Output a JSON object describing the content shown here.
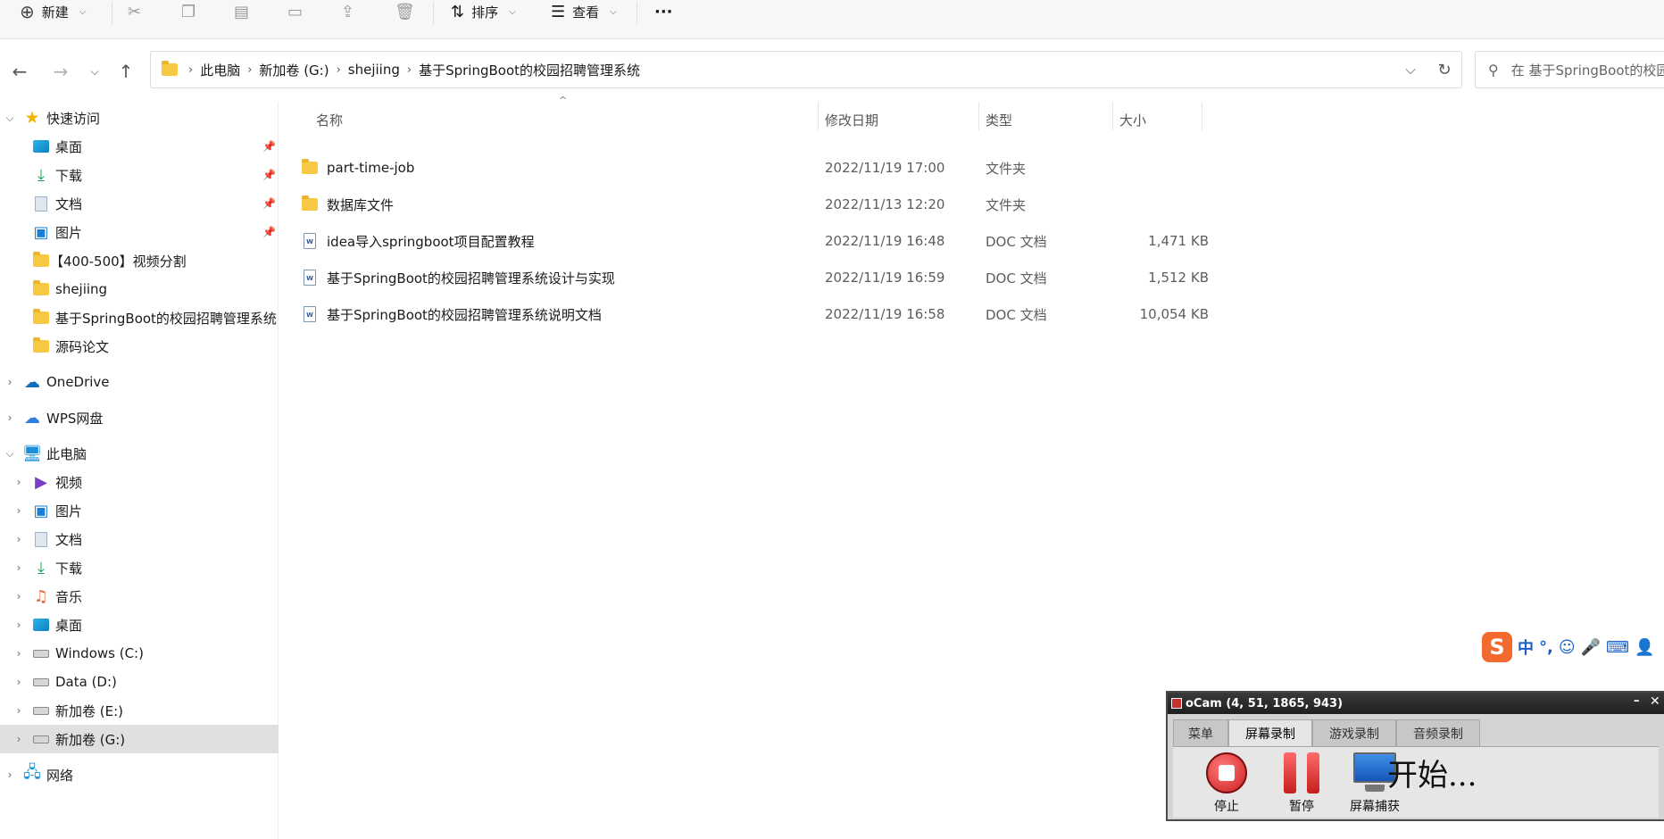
{
  "toolbar": {
    "new_label": "新建",
    "sort_label": "排序",
    "view_label": "查看",
    "more_label": "···"
  },
  "address": {
    "crumbs": [
      "此电脑",
      "新加卷 (G:)",
      "shejiing",
      "基于SpringBoot的校园招聘管理系统"
    ],
    "search_placeholder": "在 基于SpringBoot的校园招聘管理系统 中搜索"
  },
  "sidebar": {
    "quick_access": "快速访问",
    "quick_items": [
      "桌面",
      "下载",
      "文档",
      "图片",
      "【400-500】视频分割",
      "shejiing",
      "基于SpringBoot的校园招聘管理系统",
      "源码论文"
    ],
    "onedrive": "OneDrive",
    "wps": "WPS网盘",
    "this_pc": "此电脑",
    "pc_items": [
      "视频",
      "图片",
      "文档",
      "下载",
      "音乐",
      "桌面",
      "Windows (C:)",
      "Data (D:)",
      "新加卷 (E:)",
      "新加卷 (G:)"
    ],
    "network": "网络"
  },
  "columns": {
    "name": "名称",
    "date": "修改日期",
    "type": "类型",
    "size": "大小"
  },
  "files": [
    {
      "name": "part-time-job",
      "date": "2022/11/19 17:00",
      "type": "文件夹",
      "size": "",
      "icon": "folder-icon"
    },
    {
      "name": "数据库文件",
      "date": "2022/11/13 12:20",
      "type": "文件夹",
      "size": "",
      "icon": "folder-icon"
    },
    {
      "name": "idea导入springboot项目配置教程",
      "date": "2022/11/19 16:48",
      "type": "DOC 文档",
      "size": "1,471 KB",
      "icon": "doc-icon"
    },
    {
      "name": "基于SpringBoot的校园招聘管理系统设计与实现",
      "date": "2022/11/19 16:59",
      "type": "DOC 文档",
      "size": "1,512 KB",
      "icon": "doc-icon"
    },
    {
      "name": "基于SpringBoot的校园招聘管理系统说明文档",
      "date": "2022/11/19 16:58",
      "type": "DOC 文档",
      "size": "10,054 KB",
      "icon": "doc-icon"
    }
  ],
  "ime": {
    "logo": "S",
    "lang": "中",
    "punct": "°,"
  },
  "ocam": {
    "title": "oCam (4, 51, 1865, 943)",
    "tabs": [
      "菜单",
      "屏幕录制",
      "游戏录制",
      "音频录制"
    ],
    "stop_label": "停止",
    "pause_label": "暂停",
    "capture_label": "屏幕捕获",
    "status": "开始..."
  }
}
